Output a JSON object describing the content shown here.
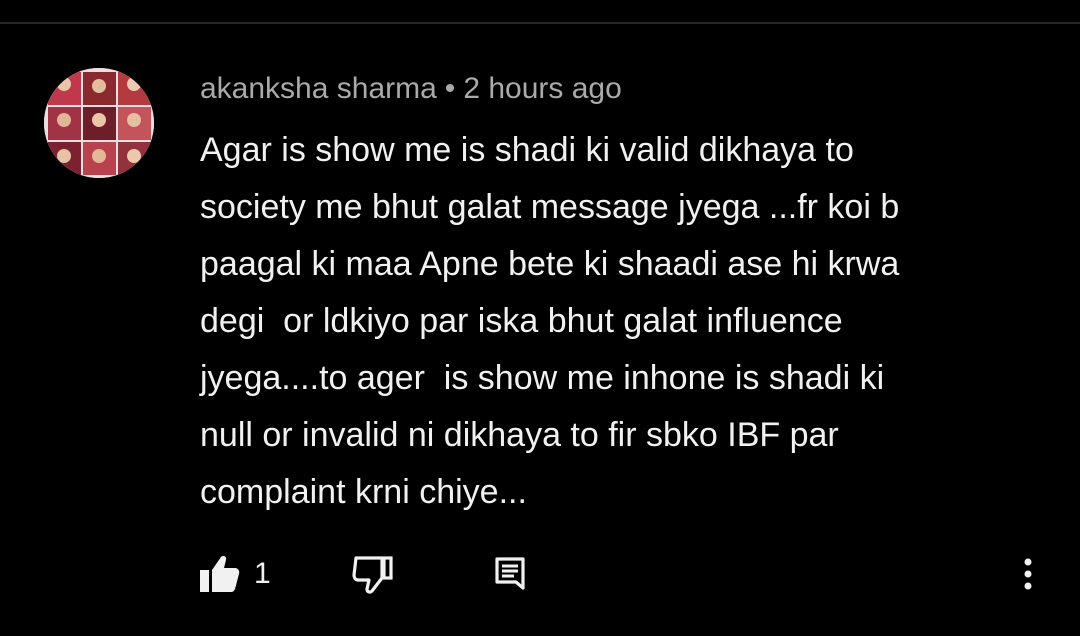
{
  "comment": {
    "author": "akanksha sharma",
    "separator": "•",
    "time": "2 hours ago",
    "text": "Agar is show me is shadi ki valid dikhaya to\nsociety me bhut galat message jyega ...fr koi b\npaagal ki maa Apne bete ki shaadi ase hi krwa\ndegi  or ldkiyo par iska bhut galat influence\njyega....to ager  is show me inhone is shadi ki\nnull or invalid ni dikhaya to fir sbko IBF par\ncomplaint krni chiye...",
    "like_count": "1"
  },
  "icons": {
    "like": "thumbs-up-icon",
    "dislike": "thumbs-down-icon",
    "reply": "reply-comment-icon",
    "more": "more-vertical-icon"
  },
  "colors": {
    "background": "#000000",
    "text": "#f1f1f1",
    "meta": "#aaaaaa",
    "divider": "#272727"
  }
}
